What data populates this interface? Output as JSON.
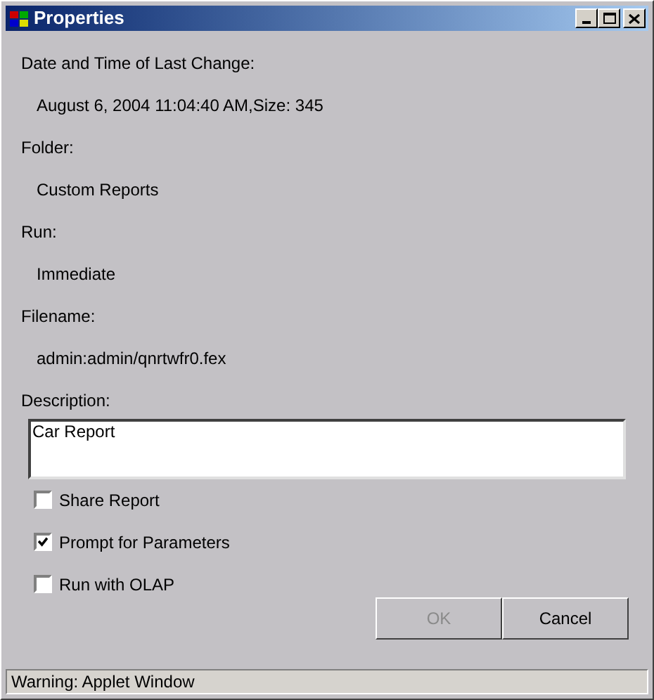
{
  "window": {
    "title": "Properties"
  },
  "properties": [
    {
      "label": "Date and Time of Last Change:",
      "value": "August 6, 2004 11:04:40 AM,Size: 345"
    },
    {
      "label": "Folder:",
      "value": "Custom Reports"
    },
    {
      "label": "Run:",
      "value": "Immediate"
    },
    {
      "label": "Filename:",
      "value": "admin:admin/qnrtwfr0.fex"
    }
  ],
  "description": {
    "label": "Description:",
    "value": "Car Report"
  },
  "options": [
    {
      "label": "Share Report",
      "checked": false
    },
    {
      "label": "Prompt for Parameters",
      "checked": true
    },
    {
      "label": "Run with OLAP",
      "checked": false
    }
  ],
  "buttons": [
    {
      "label": "OK",
      "disabled": true
    },
    {
      "label": "Cancel",
      "disabled": false
    }
  ],
  "status_bar": "Warning: Applet Window"
}
